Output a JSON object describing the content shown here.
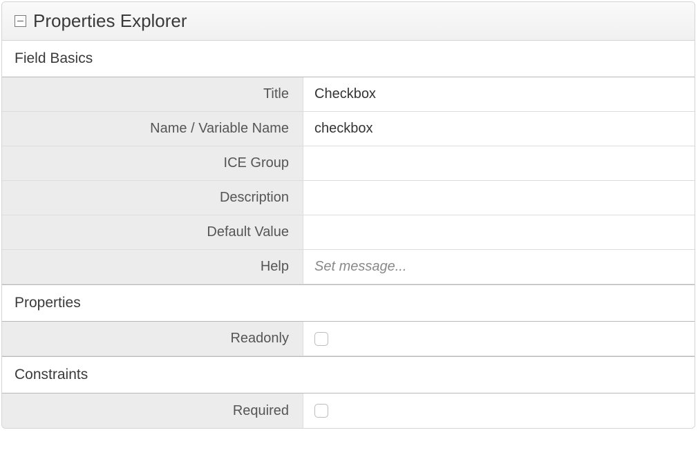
{
  "panel": {
    "title": "Properties Explorer"
  },
  "sections": {
    "field_basics": {
      "title": "Field Basics",
      "rows": {
        "title": {
          "label": "Title",
          "value": "Checkbox"
        },
        "name": {
          "label": "Name / Variable Name",
          "value": "checkbox"
        },
        "ice_group": {
          "label": "ICE Group",
          "value": ""
        },
        "description": {
          "label": "Description",
          "value": ""
        },
        "default_value": {
          "label": "Default Value",
          "value": ""
        },
        "help": {
          "label": "Help",
          "value": "",
          "placeholder": "Set message..."
        }
      }
    },
    "properties": {
      "title": "Properties",
      "rows": {
        "readonly": {
          "label": "Readonly",
          "checked": false
        }
      }
    },
    "constraints": {
      "title": "Constraints",
      "rows": {
        "required": {
          "label": "Required",
          "checked": false
        }
      }
    }
  }
}
